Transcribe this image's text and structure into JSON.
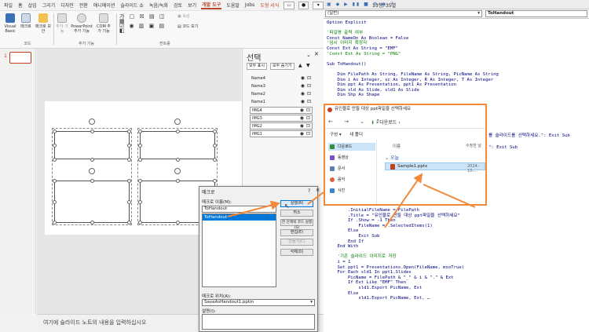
{
  "ppt": {
    "menu_tabs": [
      "파일",
      "홈",
      "삽입",
      "그리기",
      "디자인",
      "전환",
      "애니메이션",
      "슬라이드 쇼",
      "녹음/녹화",
      "검토",
      "보기",
      "개발 도구",
      "도움말",
      "Jobs",
      "도형 서식"
    ],
    "active_tab": "개발 도구",
    "ribbon": {
      "visual_basic": "Visual Basic",
      "macro": "매크로",
      "macro_security": "매크로 보안",
      "group_code": "코드",
      "addins": "추가 기능",
      "ppt_addins": "PowerPoint 추가 기능",
      "com_addins": "COM 추가 기능",
      "group_addins": "추가 기능",
      "group_controls": "컨트롤",
      "properties": "속성",
      "view_code": "코드 보기"
    },
    "slide_number": "1",
    "notes_placeholder": "여기에 슬라이드 노트의 내용을 입력하십시오",
    "selection_pane": {
      "title": "선택",
      "show_all": "모두 표시",
      "hide_all": "모두 숨기기",
      "items": [
        "Name4",
        "Name3",
        "Name2",
        "Name1",
        "IMG4",
        "IMG3",
        "IMG2",
        "IMG1"
      ]
    }
  },
  "macro_dialog": {
    "title": "매크로",
    "help": "?",
    "name_label": "매크로 이름(M):",
    "name_value": "ToHandout",
    "list": [
      "ToHandout"
    ],
    "buttons": [
      "실행(R)",
      "취소",
      "한 단계씩 코드 실행(S)",
      "편집(E)",
      "만들기(C)",
      "삭제(D)"
    ],
    "location_label": "매크로 위치(A):",
    "location_value": "SaveAsHandout1.pptm",
    "desc_label": "설명(I):"
  },
  "vba": {
    "title_tail": "13행, 35열",
    "object_combo": "(일반)",
    "proc_combo": "ToHandout",
    "code_lines": [
      {
        "t": "Option Explicit",
        "c": "k"
      },
      {
        "t": "",
        "c": "k"
      },
      {
        "t": "'파일명 출력 여부",
        "c": "g"
      },
      {
        "t": "Const NameOn As Boolean = False",
        "c": "k"
      },
      {
        "t": "'임시 이미지 확장자",
        "c": "g"
      },
      {
        "t": "Const Ext As String = \"EMF\"",
        "c": "k"
      },
      {
        "t": "'Const Ext As String = \"PNG\"",
        "c": "g"
      },
      {
        "t": "",
        "c": "k"
      },
      {
        "t": "Sub ToHandout()",
        "c": "k"
      },
      {
        "t": "",
        "c": "k"
      },
      {
        "t": "    Dim FilePath As String, FileName As String, PicName As String",
        "c": "k"
      },
      {
        "t": "    Dim i As Integer, sc As Integer, R As Integer, T As Integer",
        "c": "k"
      },
      {
        "t": "    Dim ppt As Presentation, ppt1 As Presentation",
        "c": "k"
      },
      {
        "t": "    Dim sld As Slide, sld1 As Slide",
        "c": "k"
      },
      {
        "t": "    Dim Shp As Shape",
        "c": "k"
      }
    ],
    "code_mid_right": [
      "를 슬라이드를 선택하세요.\": Exit Sub",
      "\": Exit Sub"
    ],
    "code_lower": [
      {
        "t": "        .InitialFileName = FilePath",
        "c": "k"
      },
      {
        "t": "        .Title = \"유인물로 만들 대상 ppt파일을 선택하세요\"",
        "c": "k"
      },
      {
        "t": "        If .Show = -1 Then",
        "c": "k"
      },
      {
        "t": "            FileName = .SelectedItems(1)",
        "c": "k"
      },
      {
        "t": "        Else",
        "c": "k"
      },
      {
        "t": "            Exit Sub",
        "c": "k"
      },
      {
        "t": "        End If",
        "c": "k"
      },
      {
        "t": "    End With",
        "c": "k"
      },
      {
        "t": "",
        "c": "k"
      },
      {
        "t": "    '기존 슬라이드 이미지로 저장",
        "c": "g"
      },
      {
        "t": "    i = 1",
        "c": "k"
      },
      {
        "t": "    Set ppt1 = Presentations.Open(FileName, msoTrue)",
        "c": "k"
      },
      {
        "t": "    For Each sld1 In ppt1.Slides",
        "c": "k"
      },
      {
        "t": "        PicName = FilePath & \"_\" & i & \".\" & Ext",
        "c": "k"
      },
      {
        "t": "        If Ext Like \"EMF\" Then",
        "c": "k"
      },
      {
        "t": "            sld1.Export PicName, Ext",
        "c": "k"
      },
      {
        "t": "        Else",
        "c": "k"
      },
      {
        "t": "            sld1.Export PicName, Ext, …",
        "c": "k"
      }
    ]
  },
  "file_dialog": {
    "title": "유인물로 만들 대상 ppt파일을 선택하세요",
    "breadcrumb": "다운로드",
    "arrange": "구성 ▾",
    "new_folder": "새 폴더",
    "sidebar": [
      "다운로드",
      "동영상",
      "문서",
      "음악",
      "사진"
    ],
    "col_name": "이름",
    "col_date": "수정한 날",
    "group_today": "오늘",
    "file_name": "Sample1.pptx",
    "file_date": "2024-10-..."
  },
  "colors": {
    "accent": "#f28a3c",
    "ppt_red": "#c43e1c"
  }
}
